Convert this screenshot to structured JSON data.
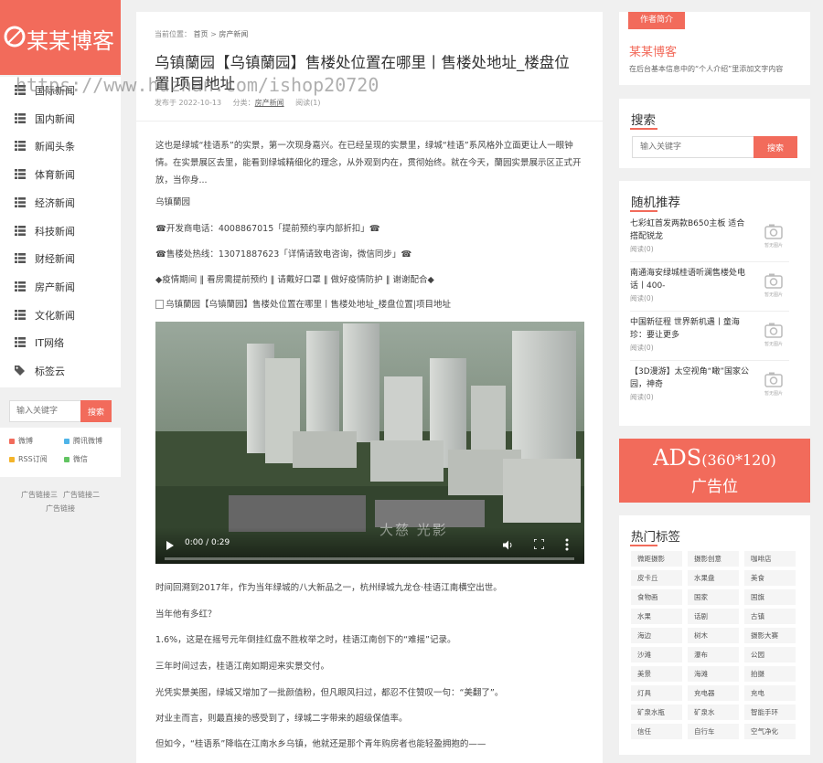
{
  "brand": {
    "logo_text": "某某博客"
  },
  "watermark": "https://www.huzhan.com/ishop20720",
  "nav": {
    "items": [
      {
        "label": "国际新闻",
        "icon": "list-icon"
      },
      {
        "label": "国内新闻",
        "icon": "list-icon"
      },
      {
        "label": "新闻头条",
        "icon": "list-icon"
      },
      {
        "label": "体育新闻",
        "icon": "list-icon"
      },
      {
        "label": "经济新闻",
        "icon": "list-icon"
      },
      {
        "label": "科技新闻",
        "icon": "list-icon"
      },
      {
        "label": "财经新闻",
        "icon": "list-icon"
      },
      {
        "label": "房产新闻",
        "icon": "list-icon"
      },
      {
        "label": "文化新闻",
        "icon": "list-icon"
      },
      {
        "label": "IT网络",
        "icon": "list-icon"
      },
      {
        "label": "标签云",
        "icon": "tag-icon"
      }
    ]
  },
  "left_search": {
    "placeholder": "输入关键字",
    "button": "搜索"
  },
  "social": [
    {
      "label": "微博",
      "color": "#f26b5b"
    },
    {
      "label": "腾讯微博",
      "color": "#4fb4e8"
    },
    {
      "label": "RSS订阅",
      "color": "#f4b42a"
    },
    {
      "label": "微信",
      "color": "#62c462"
    }
  ],
  "ad_links": [
    "广告链接三",
    "广告链接二",
    "广告链接"
  ],
  "breadcrumb": {
    "prefix": "当前位置：",
    "home": "首页",
    "sep": " > ",
    "category": "房产新闻"
  },
  "article": {
    "title": "乌镇蘭园【乌镇蘭园】售楼处位置在哪里丨售楼处地址_楼盘位置|项目地址",
    "meta": {
      "date": "发布于 2022-10-13",
      "cat_prefix": "分类：",
      "category": "房产新闻",
      "views": "阅读(1)"
    },
    "lead": "这也是绿城“桂语系”的实景，第一次现身嘉兴。在已经呈现的实景里，绿城“桂语”系风格外立面更让人一眼钟情。在实景展区去里，能看到绿城精细化的理念，从外观到内在，贯彻始终。就在今天，蘭园实景展示区正式开放，当你身...",
    "paragraphs": [
      "乌镇蘭园",
      "☎开发商电话：4008867015「提前预约享内部折扣」☎",
      "☎售楼处热线：13071887623「详情请致电咨询，微信同步」☎",
      "◆疫情期间 ‖ 看房需提前预约 ‖ 请戴好口罩 ‖ 做好疫情防护 ‖ 谢谢配合◆"
    ],
    "image_alt": "乌镇蘭园【乌镇蘭园】售楼处位置在哪里丨售楼处地址_楼盘位置|项目地址",
    "video": {
      "time": "0:00 / 0:29",
      "watermark": "大慈 光影"
    },
    "after": [
      "时间回溯到2017年，作为当年绿城的八大新品之一，杭州绿城九龙仓·桂语江南横空出世。",
      "当年他有多红？",
      "1.6%，这是在摇号元年倒挂红盘不胜枚举之时，桂语江南创下的“难摇”记录。",
      "三年时间过去，桂语江南如期迎来实景交付。",
      "光凭实景美图，绿城又增加了一批颜值粉，但凡眼风扫过，都忍不住赞叹一句：“美翻了”。",
      "对业主而言，则最直接的感受到了，绿城二字带来的超级保值率。",
      "但如今，“桂语系”降临在江南水乡乌镇，他就还是那个青年购房者也能轻盈拥抱的——"
    ]
  },
  "about": {
    "tag": "作者简介",
    "name": "某某博客",
    "desc": "在后台基本信息中的“个人介绍”里添加文字内容"
  },
  "right_search": {
    "title": "搜索",
    "placeholder": "输入关键字",
    "button": "搜索"
  },
  "random": {
    "title": "随机推荐",
    "items": [
      {
        "title": "七彩虹首发两款B650主板 适合搭配锐龙",
        "views": "阅读(0)"
      },
      {
        "title": "南通海安绿城桂语听澜售楼处电话丨400-",
        "views": "阅读(0)"
      },
      {
        "title": "中国新征程 世界新机遇丨童海珍：要让更多",
        "views": "阅读(0)"
      },
      {
        "title": "【3D漫游】太空视角“瞰”国家公园，神奇",
        "views": "阅读(0)"
      }
    ],
    "nopic_label": "暂无图片"
  },
  "ads": {
    "size_prefix": "ADS",
    "size": "(360*120)",
    "label": "广告位"
  },
  "hot_tags": {
    "title": "热门标签",
    "tags": [
      "微距摄影",
      "摄影创意",
      "咖啡店",
      "皮卡丘",
      "水果盘",
      "美食",
      "食物画",
      "国家",
      "国旗",
      "水果",
      "话剧",
      "古镇",
      "海边",
      "树木",
      "摄影大赛",
      "沙滩",
      "瀑布",
      "公园",
      "美景",
      "海滩",
      "拍摄",
      "灯具",
      "充电器",
      "充电",
      "矿泉水瓶",
      "矿泉水",
      "智能手环",
      "信任",
      "自行车",
      "空气净化"
    ]
  }
}
